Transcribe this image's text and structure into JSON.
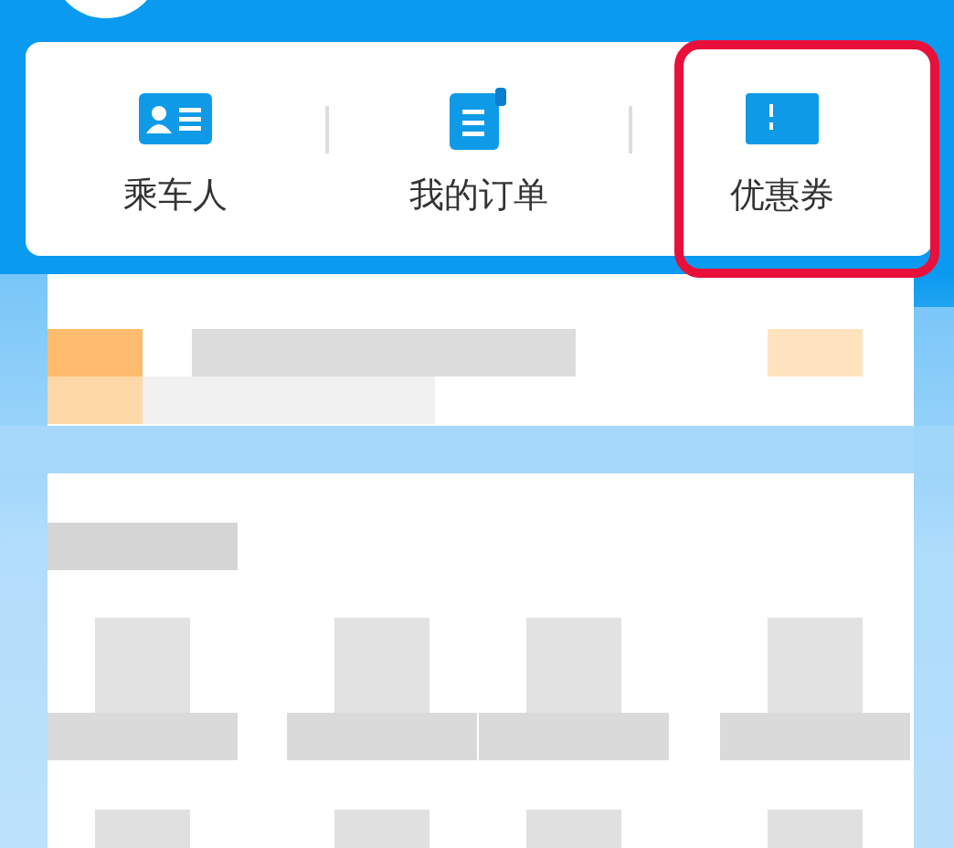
{
  "shortcuts": [
    {
      "kind": "passenger",
      "label": "乘车人",
      "highlighted": false
    },
    {
      "kind": "order",
      "label": "我的订单",
      "highlighted": false
    },
    {
      "kind": "coupon",
      "label": "优惠券",
      "highlighted": true
    }
  ]
}
